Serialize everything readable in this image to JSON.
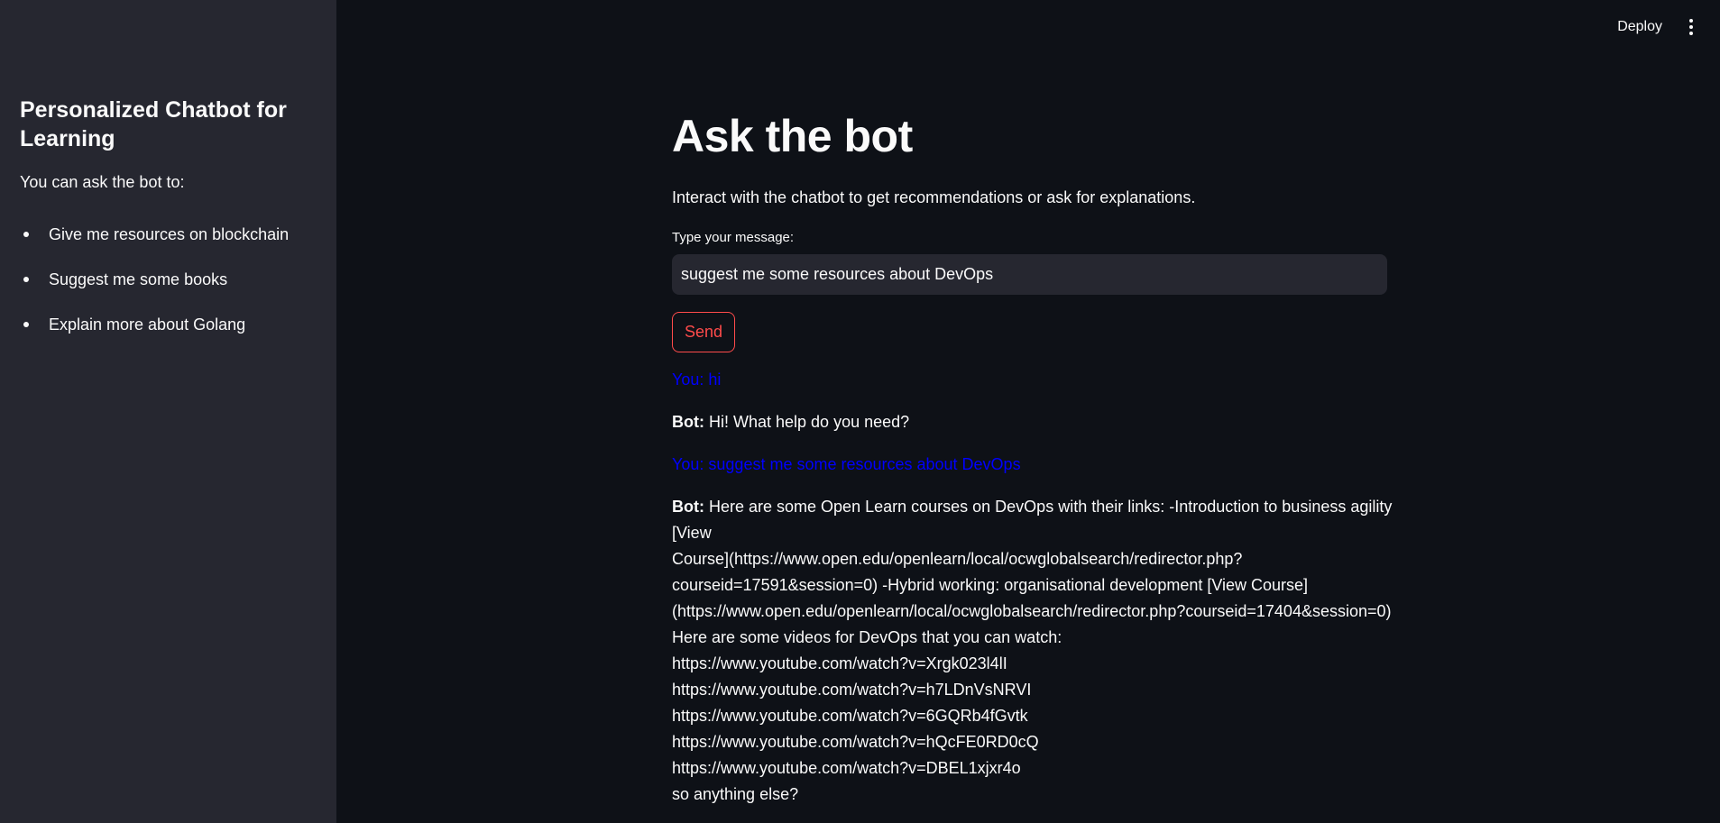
{
  "topbar": {
    "deploy_label": "Deploy",
    "menu_icon": "vertical-dots-icon"
  },
  "sidebar": {
    "title": "Personalized Chatbot for Learning",
    "intro": "You can ask the bot to:",
    "items": [
      "Give me resources on blockchain",
      "Suggest me some books",
      "Explain more about Golang"
    ]
  },
  "main": {
    "title": "Ask the bot",
    "description": "Interact with the chatbot to get recommendations or ask for explanations.",
    "input_label": "Type your message:",
    "input_value": "suggest me some resources about DevOps",
    "send_label": "Send"
  },
  "chat": {
    "user_prefix": "You:",
    "bot_prefix": "Bot:",
    "user_1": "hi",
    "bot_1": "Hi! What help do you need?",
    "user_2": "suggest me some resources about DevOps",
    "bot_2_lines": [
      "Here are some Open Learn courses on DevOps with their links: -Introduction to business agility [View",
      "Course](https://www.open.edu/openlearn/local/ocwglobalsearch/redirector.php?",
      "courseid=17591&session=0) -Hybrid working: organisational development [View Course]",
      "(https://www.open.edu/openlearn/local/ocwglobalsearch/redirector.php?courseid=17404&session=0)",
      "Here are some videos for DevOps that you can watch:",
      "https://www.youtube.com/watch?v=Xrgk023l4lI",
      "https://www.youtube.com/watch?v=h7LDnVsNRVI",
      "https://www.youtube.com/watch?v=6GQRb4fGvtk",
      "https://www.youtube.com/watch?v=hQcFE0RD0cQ",
      "https://www.youtube.com/watch?v=DBEL1xjxr4o",
      "so anything else?"
    ]
  },
  "colors": {
    "background": "#0e1117",
    "sidebar": "#262730",
    "user_text": "#0000ff",
    "accent": "#ff4b4b"
  }
}
